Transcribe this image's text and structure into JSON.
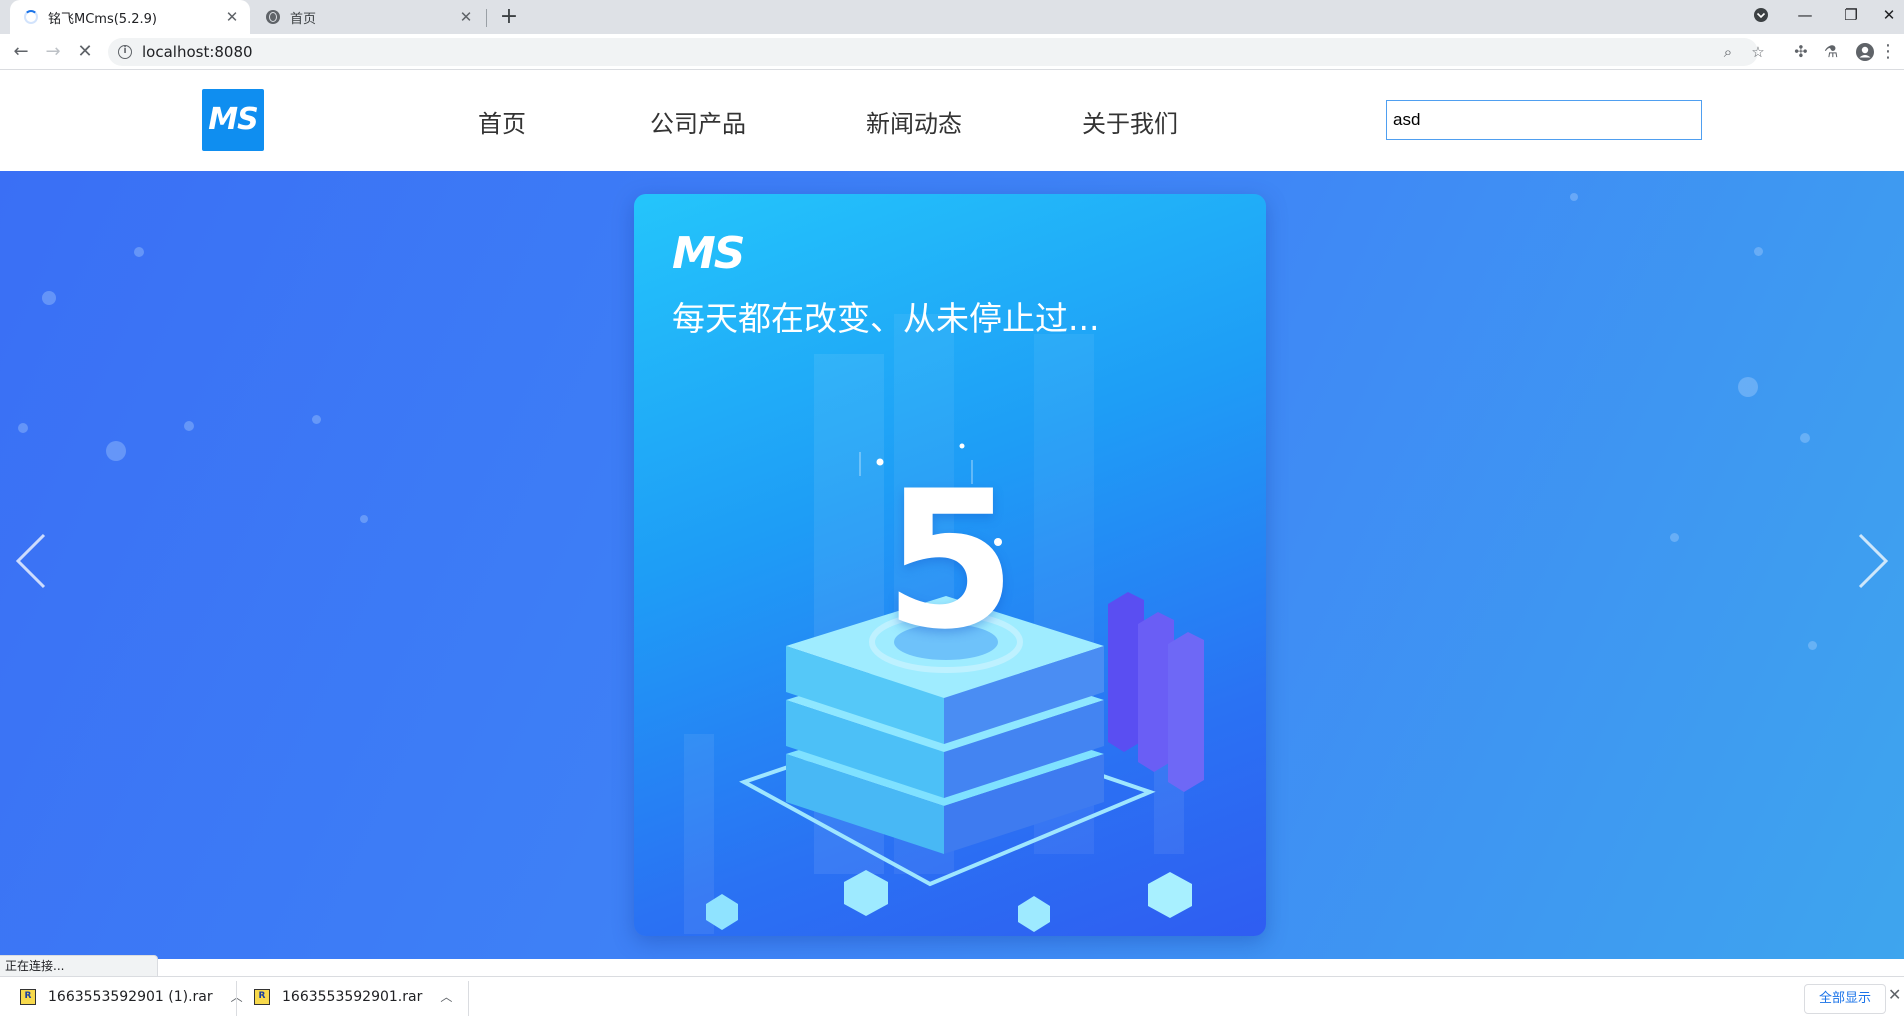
{
  "browser": {
    "tabs": [
      {
        "title": "铭飞MCms(5.2.9)",
        "loading": true
      },
      {
        "title": "首页",
        "loading": false
      }
    ],
    "address": "localhost:8080",
    "status_text": "正在连接..."
  },
  "site": {
    "logo_text": "MS",
    "nav": [
      "首页",
      "公司产品",
      "新闻动态",
      "关于我们"
    ],
    "search_value": "asd"
  },
  "banner": {
    "logo_text": "MS",
    "slogan": "每天都在改变、从未停止过...",
    "version_number": "5"
  },
  "downloads": {
    "items": [
      "1663553592901 (1).rar",
      "1663553592901.rar"
    ],
    "show_all": "全部显示"
  },
  "colors": {
    "brand": "#0f8ef0",
    "banner_start": "#3a6ff5",
    "banner_end": "#3ea5ee",
    "link_blue": "#1a73e8"
  }
}
